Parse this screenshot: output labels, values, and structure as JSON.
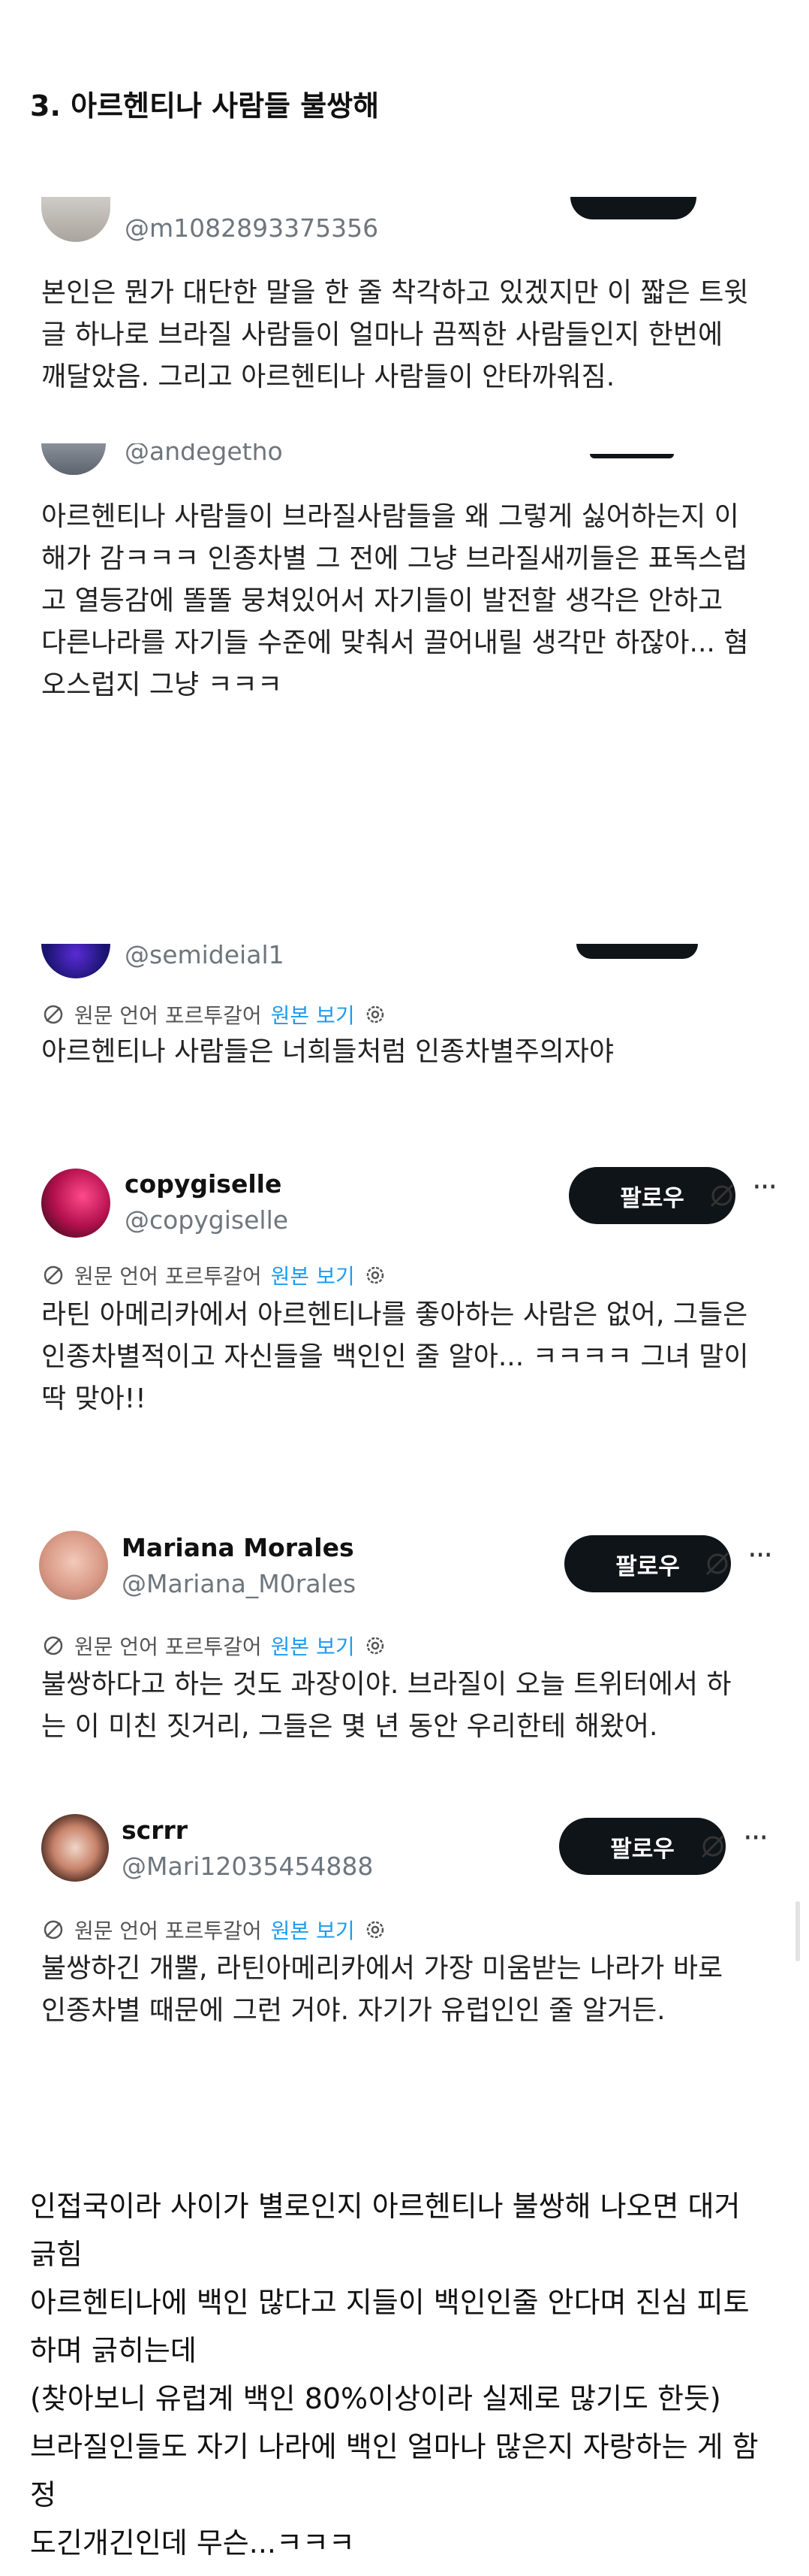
{
  "section_title": "3. 아르헨티나 사람들 불쌍해",
  "tweets": [
    {
      "handle": "@m1082893375356",
      "lines": [
        "본인은 뭔가 대단한 말을 한 줄 착각하고 있겠지만 이 짧은 트윗",
        "글 하나로 브라질 사람들이 얼마나 끔찍한 사람들인지 한번에",
        "깨달았음. 그리고 아르헨티나 사람들이 안타까워짐."
      ]
    },
    {
      "handle": "@andegetho",
      "lines": [
        "아르헨티나 사람들이 브라질사람들을 왜 그렇게 싫어하는지 이",
        "해가 감ㅋㅋㅋ 인종차별 그 전에 그냥 브라질새끼들은 표독스럽",
        "고 열등감에 똘똘 뭉쳐있어서 자기들이 발전할 생각은 안하고",
        "다른나라를 자기들 수준에 맞춰서 끌어내릴 생각만 하잖아... 혐",
        "오스럽지 그냥 ㅋㅋㅋ"
      ]
    },
    {
      "handle": "@semideial1",
      "translation": {
        "note": "원문 언어 포르투갈어",
        "link": "원본 보기"
      },
      "lines": [
        "아르헨티나 사람들은 너희들처럼 인종차별주의자야"
      ]
    },
    {
      "name": "copygiselle",
      "handle": "@copygiselle",
      "follow": "팔로우",
      "translation": {
        "note": "원문 언어 포르투갈어",
        "link": "원본 보기"
      },
      "lines": [
        "라틴 아메리카에서 아르헨티나를 좋아하는 사람은 없어, 그들은",
        "인종차별적이고 자신들을 백인인 줄 알아... ㅋㅋㅋㅋ 그녀 말이",
        "딱 맞아!!"
      ]
    },
    {
      "name": "Mariana Morales",
      "handle": "@Mariana_M0rales",
      "follow": "팔로우",
      "translation": {
        "note": "원문 언어 포르투갈어",
        "link": "원본 보기"
      },
      "lines": [
        "불쌍하다고 하는 것도 과장이야. 브라질이 오늘 트위터에서 하",
        "는 이 미친 짓거리, 그들은 몇 년 동안 우리한테 해왔어."
      ]
    },
    {
      "name": "scrrr",
      "handle": "@Mari12035454888",
      "follow": "팔로우",
      "translation": {
        "note": "원문 언어 포르투갈어",
        "link": "원본 보기"
      },
      "lines": [
        "불쌍하긴 개뿔, 라틴아메리카에서 가장 미움받는 나라가 바로",
        "인종차별 때문에 그런 거야. 자기가 유럽인인 줄 알거든."
      ]
    }
  ],
  "footer_lines": [
    "인접국이라 사이가 별로인지 아르헨티나 불쌍해 나오면 대거",
    "긁힘",
    "아르헨티나에 백인 많다고 지들이 백인인줄 안다며 진심 피토",
    "하며 긁히는데",
    "(찾아보니 유럽계 백인 80%이상이라 실제로 많기도 한듯)",
    "브라질인들도 자기 나라에 백인 얼마나 많은지 자랑하는 게 함",
    "정",
    "도긴개긴인데 무슨...ㅋㅋㅋ"
  ],
  "colors": {
    "link": "#1d9bf0",
    "button": "#0f1419",
    "muted": "#6e767d"
  },
  "icons": [
    "translate-icon",
    "gear-icon",
    "grok-icon",
    "more-icon"
  ]
}
